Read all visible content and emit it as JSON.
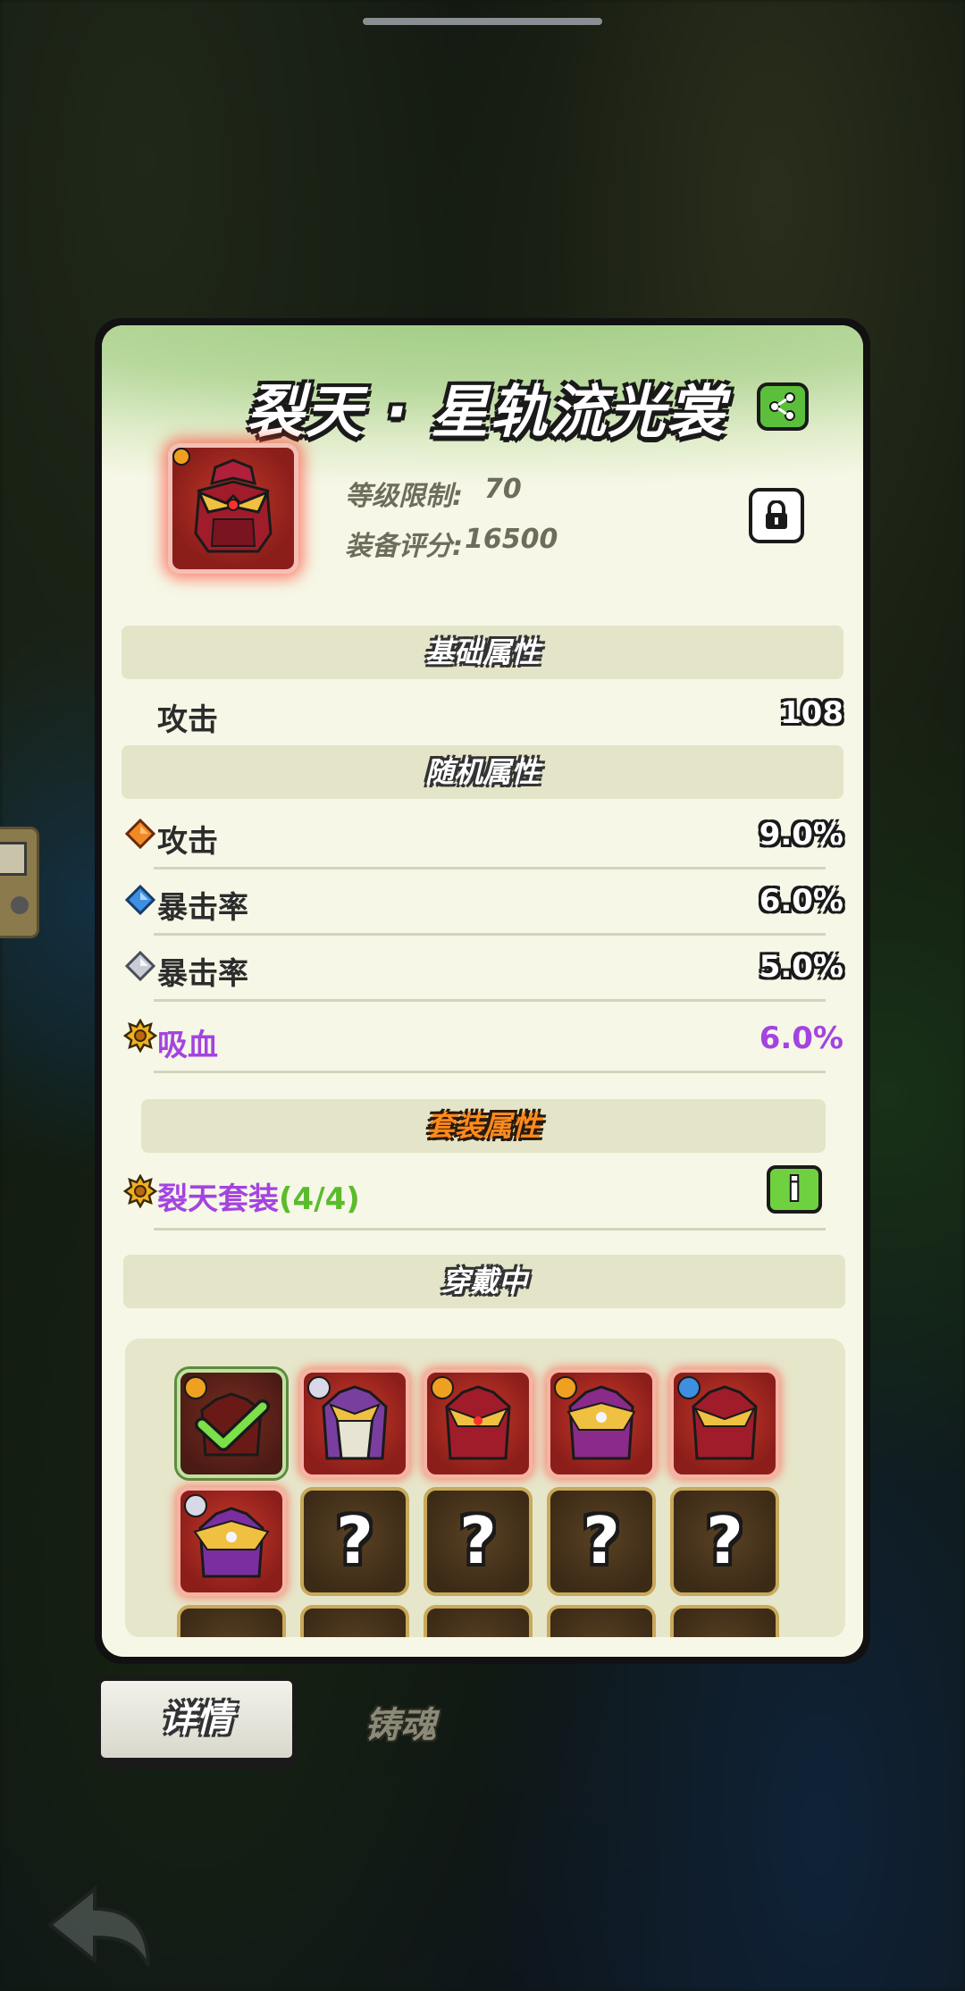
{
  "title": "裂天 · 星轨流光裳",
  "level_label": "等级限制:",
  "level_value": "70",
  "score_label": "装备评分:",
  "score_value": "16500",
  "sections": {
    "base": "基础属性",
    "random": "随机属性",
    "set": "套装属性",
    "wearing": "穿戴中"
  },
  "base_stats": [
    {
      "label": "攻击",
      "value": "108"
    }
  ],
  "random_stats": [
    {
      "label": "攻击",
      "value": "9.0%",
      "gem": "orange-gem-icon"
    },
    {
      "label": "暴击率",
      "value": "6.0%",
      "gem": "blue-gem-icon"
    },
    {
      "label": "暴击率",
      "value": "5.0%",
      "gem": "silver-gem-icon"
    },
    {
      "label": "吸血",
      "value": "6.0%",
      "gem": "gold-sun-icon"
    }
  ],
  "set_bonus": {
    "name": "裂天套装",
    "count": "(4/4)",
    "info_label": "i"
  },
  "tabs": {
    "details": "详情",
    "forge": "铸魂"
  },
  "colors": {
    "accent_green": "#5bbf3b",
    "purple": "#a444e0",
    "orange": "#ff8a1c"
  }
}
